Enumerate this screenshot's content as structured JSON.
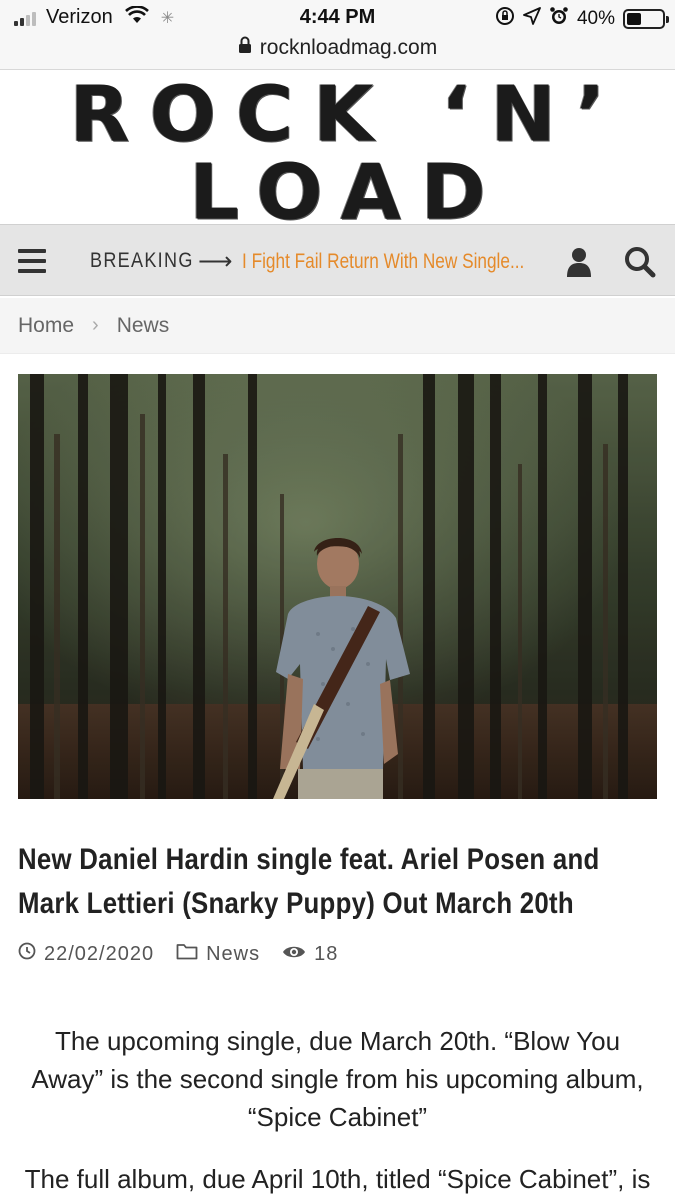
{
  "status_bar": {
    "carrier": "Verizon",
    "time": "4:44 PM",
    "battery": "40%",
    "battery_level": 0.4
  },
  "browser": {
    "url": "rocknloadmag.com"
  },
  "site": {
    "logo": "ROCK ‘N’ LOAD"
  },
  "nav": {
    "breaking_label": "BREAKING",
    "ticker_text": "I Fight Fail Return With New Single..."
  },
  "breadcrumb": {
    "home": "Home",
    "section": "News"
  },
  "article": {
    "title": "New Daniel Hardin single feat. Ariel Posen and Mark Lettieri (Snarky Puppy) Out March 20th",
    "date": "22/02/2020",
    "category": "News",
    "views": "18",
    "paragraph_1": "The upcoming single, due March 20th. “Blow You Away” is the second single from his upcoming album, “Spice Cabinet”",
    "paragraph_2": "The full album, due April 10th, titled “Spice Cabinet”, is"
  },
  "colors": {
    "accent": "#e58a2a",
    "nav_bg": "#e5e5e5"
  }
}
